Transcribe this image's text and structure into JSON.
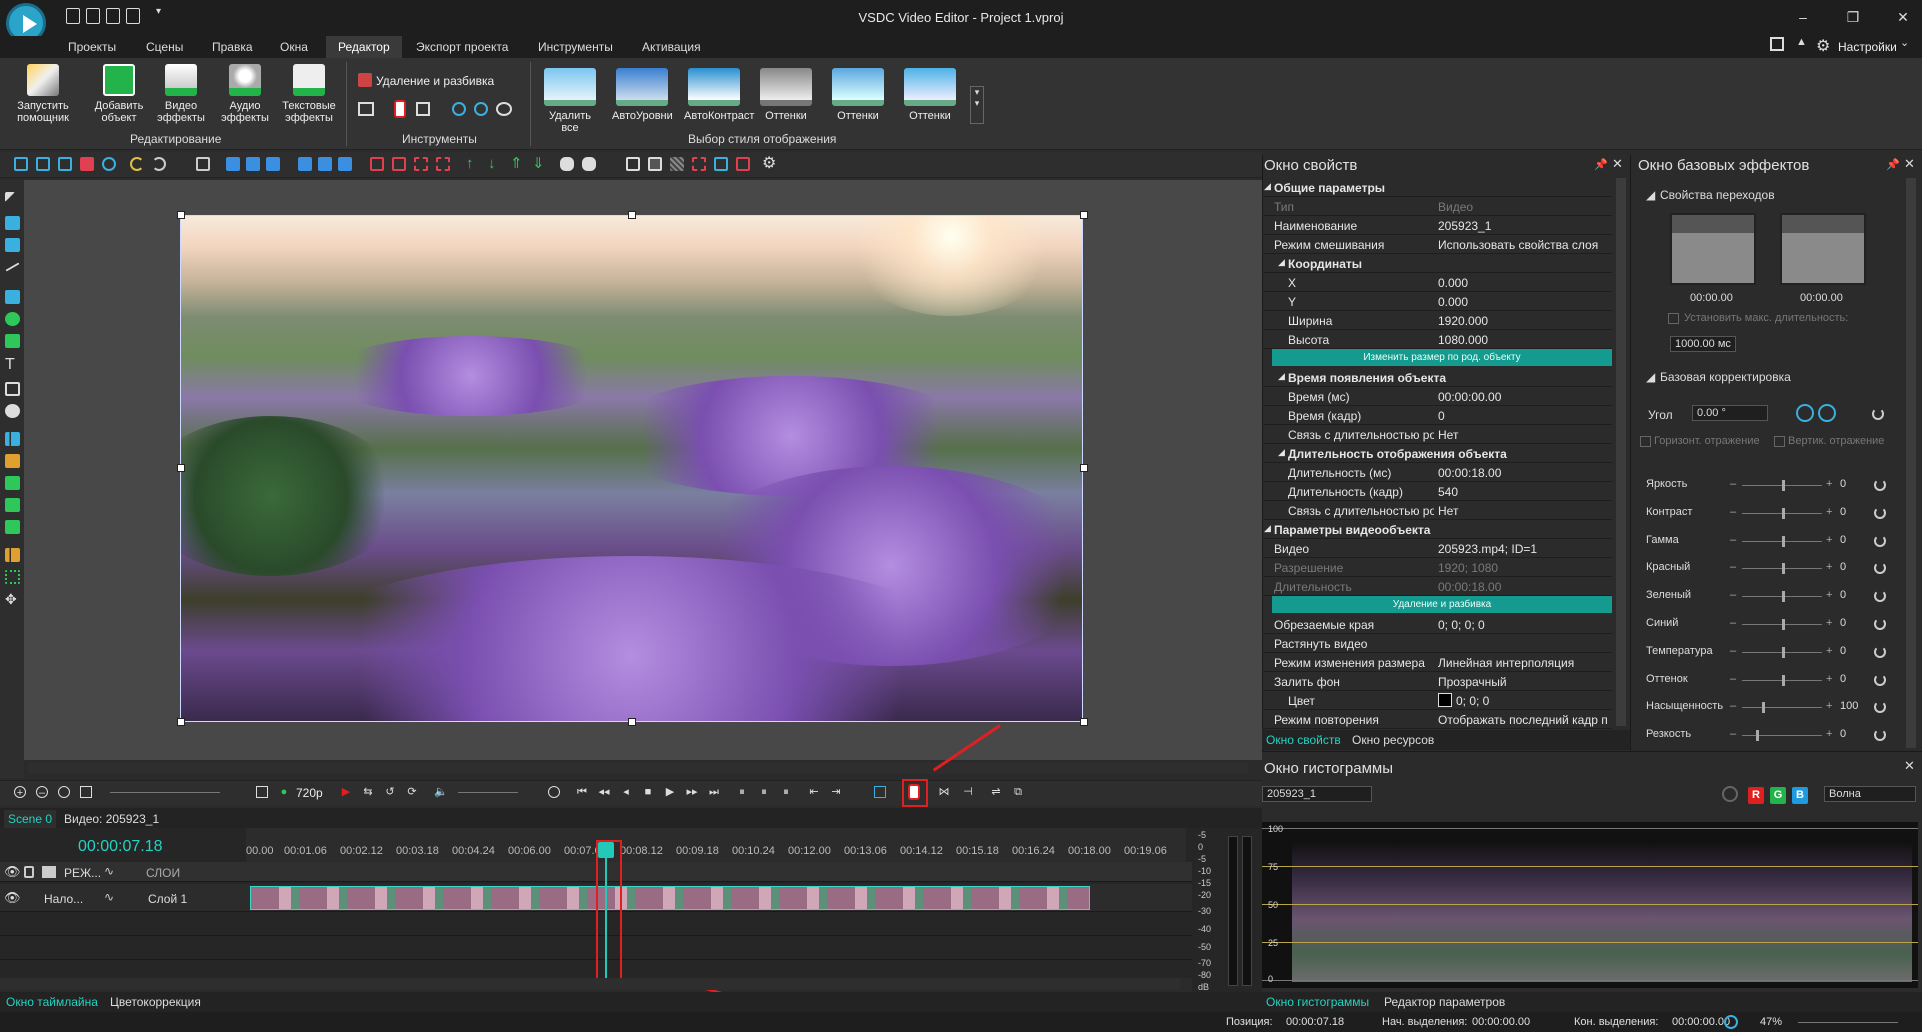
{
  "window": {
    "title": "VSDC Video Editor - Project 1.vproj",
    "settings_label": "Настройки"
  },
  "menu": {
    "tabs": [
      "Проекты",
      "Сцены",
      "Правка",
      "Окна",
      "Редактор",
      "Экспорт проекта",
      "Инструменты",
      "Активация"
    ],
    "active": "Редактор"
  },
  "ribbon": {
    "buttons": [
      {
        "label": "Запустить помощник",
        "icon": "wand-icon"
      },
      {
        "label": "Добавить объект",
        "icon": "add-object-icon"
      },
      {
        "label": "Видео эффекты",
        "icon": "video-effects-icon"
      },
      {
        "label": "Аудио эффекты",
        "icon": "audio-effects-icon"
      },
      {
        "label": "Текстовые эффекты",
        "icon": "text-effects-icon"
      }
    ],
    "group_editing": "Редактирование",
    "split_label": "Удаление и разбивка",
    "group_tools": "Инструменты",
    "styles": [
      "Удалить все",
      "АвтоУровни",
      "АвтоКонтраст",
      "Оттенки",
      "Оттенки",
      "Оттенки"
    ],
    "group_styles": "Выбор стиля отображения"
  },
  "playback": {
    "resolution": "720p"
  },
  "timeline": {
    "scene_tab": "Scene 0",
    "video_tab": "Видео: 205923_1",
    "current_time": "00:00:07.18",
    "ruler_ticks": [
      "00.00",
      "00:01.06",
      "00:02.12",
      "00:03.18",
      "00:04.24",
      "00:06.00",
      "00:07.06",
      "00:08.12",
      "00:09.18",
      "00:10.24",
      "00:12.00",
      "00:13.06",
      "00:14.12",
      "00:15.18",
      "00:16.24",
      "00:18.00",
      "00:19.06"
    ],
    "header_row": {
      "mode": "РЕЖ...",
      "layers": "СЛОИ"
    },
    "track_row": {
      "mode": "Нало...",
      "layer": "Слой 1"
    },
    "meter_labels": [
      "-5",
      "0",
      "-5",
      "-10",
      "-15",
      "-20",
      "-30",
      "-40",
      "-50",
      "-70",
      "-80",
      "dB"
    ],
    "bottom_tabs": [
      "Окно таймлайна",
      "Цветокоррекция"
    ]
  },
  "properties": {
    "title": "Окно свойств",
    "rows": [
      {
        "key": "Общие параметры",
        "val": "",
        "type": "section",
        "indent": 0
      },
      {
        "key": "Тип",
        "val": "Видео",
        "type": "dim",
        "indent": 0
      },
      {
        "key": "Наименование",
        "val": "205923_1",
        "type": "row",
        "indent": 0
      },
      {
        "key": "Режим смешивания",
        "val": "Использовать свойства слоя",
        "type": "row",
        "indent": 0
      },
      {
        "key": "Координаты",
        "val": "",
        "type": "section",
        "indent": 1
      },
      {
        "key": "X",
        "val": "0.000",
        "type": "row",
        "indent": 1
      },
      {
        "key": "Y",
        "val": "0.000",
        "type": "row",
        "indent": 1
      },
      {
        "key": "Ширина",
        "val": "1920.000",
        "type": "row",
        "indent": 1
      },
      {
        "key": "Высота",
        "val": "1080.000",
        "type": "row",
        "indent": 1
      },
      {
        "key": "Изменить размер по род. объекту",
        "val": "",
        "type": "button",
        "indent": 0
      },
      {
        "key": "Время появления объекта",
        "val": "",
        "type": "section",
        "indent": 1
      },
      {
        "key": "Время (мс)",
        "val": "00:00:00.00",
        "type": "row",
        "indent": 1
      },
      {
        "key": "Время (кадр)",
        "val": "0",
        "type": "row",
        "indent": 1
      },
      {
        "key": "Связь с длительностью ро",
        "val": "Нет",
        "type": "row",
        "indent": 1
      },
      {
        "key": "Длительность отображения объекта",
        "val": "",
        "type": "section",
        "indent": 1
      },
      {
        "key": "Длительность (мс)",
        "val": "00:00:18.00",
        "type": "row",
        "indent": 1
      },
      {
        "key": "Длительность (кадр)",
        "val": "540",
        "type": "row",
        "indent": 1
      },
      {
        "key": "Связь с длительностью ро",
        "val": "Нет",
        "type": "row",
        "indent": 1
      },
      {
        "key": "Параметры видеообъекта",
        "val": "",
        "type": "section",
        "indent": 0
      },
      {
        "key": "Видео",
        "val": "205923.mp4; ID=1",
        "type": "row",
        "indent": 0
      },
      {
        "key": "Разрешение",
        "val": "1920; 1080",
        "type": "dim",
        "indent": 0
      },
      {
        "key": "Длительность",
        "val": "00:00:18.00",
        "type": "dim",
        "indent": 0
      },
      {
        "key": "Удаление и разбивка",
        "val": "",
        "type": "button",
        "indent": 0
      },
      {
        "key": "Обрезаемые края",
        "val": "0; 0; 0; 0",
        "type": "row",
        "indent": 0
      },
      {
        "key": "Растянуть видео",
        "val": "",
        "type": "row",
        "indent": 0
      },
      {
        "key": "Режим изменения размера",
        "val": "Линейная интерполяция",
        "type": "row",
        "indent": 0
      },
      {
        "key": "Залить фон",
        "val": "Прозрачный",
        "type": "row",
        "indent": 0
      },
      {
        "key": "Цвет",
        "val": "0; 0; 0",
        "type": "row",
        "indent": 1
      },
      {
        "key": "Режим повторения",
        "val": "Отображать последний кадр пс",
        "type": "row",
        "indent": 0
      }
    ],
    "tabs": [
      "Окно свойств",
      "Окно ресурсов"
    ]
  },
  "effects": {
    "title": "Окно базовых эффектов",
    "transitions_title": "Свойства переходов",
    "trans_times": [
      "00:00.00",
      "00:00.00"
    ],
    "max_duration_label": "Установить макс. длительность:",
    "max_duration_value": "1000.00 мс",
    "basic_title": "Базовая корректировка",
    "angle_label": "Угол",
    "angle_value": "0.00 °",
    "flip_h": "Горизонт. отражение",
    "flip_v": "Вертик. отражение",
    "sliders": [
      {
        "label": "Яркость",
        "value": 0,
        "pos": 0.5
      },
      {
        "label": "Контраст",
        "value": 0,
        "pos": 0.5
      },
      {
        "label": "Гамма",
        "value": 0,
        "pos": 0.5
      },
      {
        "label": "Красный",
        "value": 0,
        "pos": 0.5
      },
      {
        "label": "Зеленый",
        "value": 0,
        "pos": 0.5
      },
      {
        "label": "Синий",
        "value": 0,
        "pos": 0.5
      },
      {
        "label": "Температура",
        "value": 0,
        "pos": 0.5
      },
      {
        "label": "Оттенок",
        "value": 0,
        "pos": 0.5
      },
      {
        "label": "Насыщенность",
        "value": 100,
        "pos": 0.25
      },
      {
        "label": "Резкость",
        "value": 0,
        "pos": 0.17
      }
    ]
  },
  "histogram": {
    "title": "Окно гистограммы",
    "source": "205923_1",
    "mode": "Волна",
    "channels": [
      "R",
      "G",
      "B"
    ],
    "axis": [
      "100",
      "75",
      "50",
      "25",
      "0"
    ],
    "tabs": [
      "Окно гистограммы",
      "Редактор параметров"
    ]
  },
  "status": {
    "position_label": "Позиция:",
    "position": "00:00:07.18",
    "sel_start_label": "Нач. выделения:",
    "sel_start": "00:00:00.00",
    "sel_end_label": "Кон. выделения:",
    "sel_end": "00:00:00.00",
    "zoom": "47%"
  }
}
